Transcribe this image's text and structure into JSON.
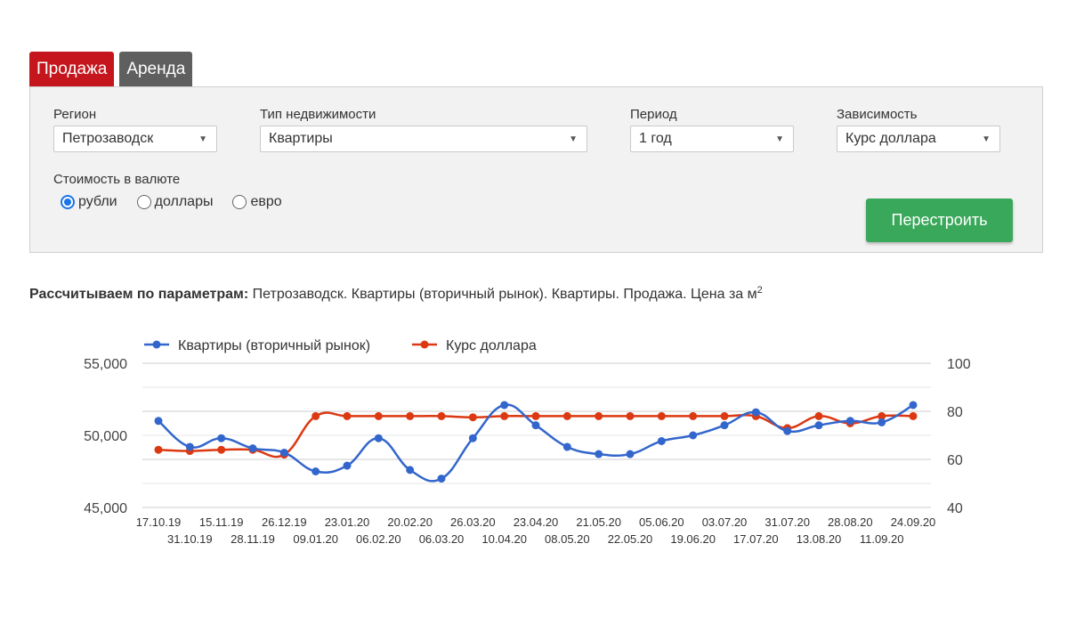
{
  "tabs": [
    {
      "label": "Продажа",
      "active": true
    },
    {
      "label": "Аренда",
      "active": false
    }
  ],
  "filters": {
    "region": {
      "label": "Регион",
      "value": "Петрозаводск"
    },
    "type": {
      "label": "Тип недвижимости",
      "value": "Квартиры"
    },
    "period": {
      "label": "Период",
      "value": "1 год"
    },
    "dependency": {
      "label": "Зависимость",
      "value": "Курс доллара"
    },
    "currency": {
      "label": "Стоимость в валюте",
      "options": [
        {
          "label": "рубли",
          "checked": true
        },
        {
          "label": "доллары",
          "checked": false
        },
        {
          "label": "евро",
          "checked": false
        }
      ]
    },
    "rebuild_label": "Перестроить"
  },
  "params": {
    "prefix": "Рассчитываем по параметрам:",
    "text": "Петрозаводск. Квартиры (вторичный рынок). Квартиры. Продажа. Цена за м",
    "sup": "2"
  },
  "colors": {
    "accent_red": "#c4161c",
    "button_green": "#3aa85a",
    "series_blue": "#3366cc",
    "series_red": "#dc3912"
  },
  "chart_data": {
    "type": "line",
    "x": [
      "17.10.19",
      "31.10.19",
      "15.11.19",
      "28.11.19",
      "26.12.19",
      "09.01.20",
      "23.01.20",
      "06.02.20",
      "20.02.20",
      "06.03.20",
      "26.03.20",
      "10.04.20",
      "23.04.20",
      "08.05.20",
      "21.05.20",
      "22.05.20",
      "05.06.20",
      "19.06.20",
      "03.07.20",
      "17.07.20",
      "31.07.20",
      "13.08.20",
      "28.08.20",
      "11.09.20",
      "24.09.20"
    ],
    "series": [
      {
        "name": "Квартиры (вторичный рынок)",
        "axis": "left",
        "values": [
          51000,
          49200,
          49800,
          49100,
          48800,
          47500,
          47900,
          49800,
          47600,
          47000,
          49800,
          52100,
          50700,
          49200,
          48700,
          48700,
          49600,
          50000,
          50700,
          51600,
          50300,
          50700,
          51000,
          50900,
          52100
        ]
      },
      {
        "name": "Курс доллара",
        "axis": "right",
        "values": [
          64,
          63.5,
          64,
          64,
          62,
          78,
          78,
          78,
          78,
          78,
          77.5,
          78,
          78,
          78,
          78,
          78,
          78,
          78,
          78,
          78,
          73,
          78,
          75,
          78,
          78
        ]
      }
    ],
    "y_left": {
      "ticks": [
        "45,000",
        "50,000",
        "55,000"
      ],
      "range": [
        45000,
        55000
      ]
    },
    "y_right": {
      "ticks": [
        "40",
        "60",
        "80",
        "100"
      ],
      "range": [
        40,
        100
      ]
    },
    "legend_position": "top-left",
    "grid": true
  }
}
